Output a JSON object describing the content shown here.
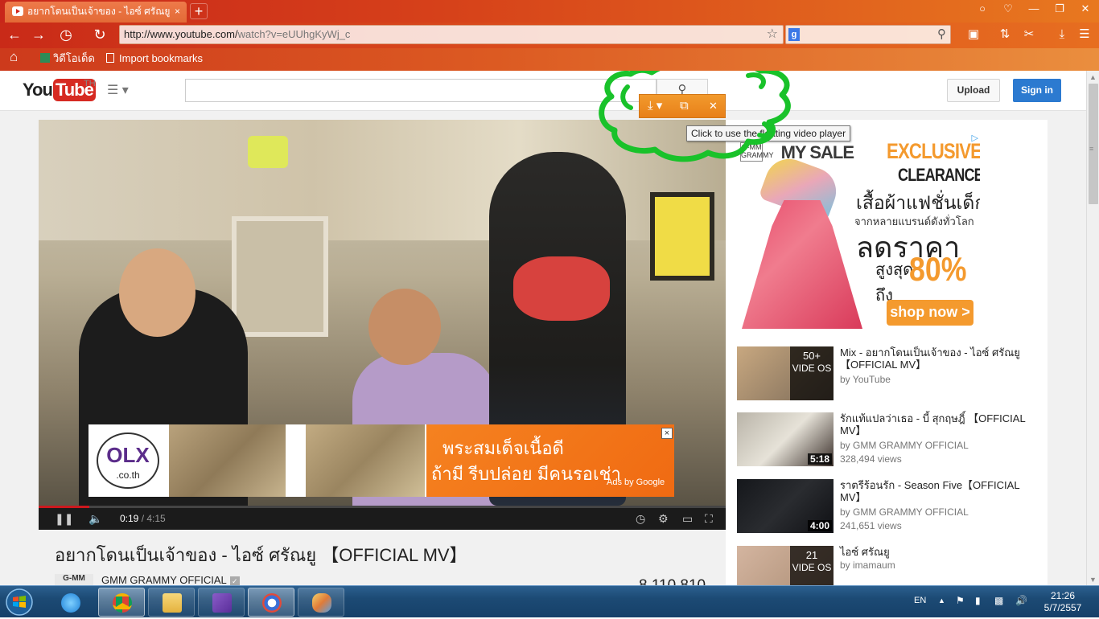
{
  "browser": {
    "tab_title": "อยากโดนเป็นเจ้าของ - ไอซ์ ศรัณยู",
    "tab_close": "×",
    "new_tab": "+",
    "url_base": "http://www.youtube.com/",
    "url_path": "watch?v=eUUhgKyWj_c",
    "search_engine_letter": "g",
    "bookmarks": [
      {
        "label": "วิดีโอเด็ด",
        "icon": "video-icon"
      },
      {
        "label": "Import bookmarks",
        "icon": "document-icon"
      }
    ]
  },
  "youtube": {
    "logo_you": "You",
    "logo_tube": "Tube",
    "region": "TH",
    "search_button_icon": "search-icon",
    "upload_label": "Upload",
    "signin_label": "Sign in"
  },
  "floating_player": {
    "tooltip": "Click to use the floating video player",
    "icons": [
      "download-icon",
      "popout-icon",
      "close-icon"
    ]
  },
  "player": {
    "current_time": "0:19",
    "separator": " / ",
    "duration": "4:15",
    "progress_fraction": 0.074,
    "ad": {
      "brand": "OLX",
      "brand_domain": ".co.th",
      "line1": "พระสมเด็จเนื้อดี",
      "line2": "ถ้ามี รีบปล่อย มีคนรอเช่า",
      "ads_by": "Ads by Google",
      "close": "×"
    }
  },
  "video": {
    "title": "อยากโดนเป็นเจ้าของ - ไอซ์ ศรัณยู 【OFFICIAL MV】",
    "channel": "GMM GRAMMY OFFICIAL",
    "channel_avatar_text": "G-MM",
    "views": "8,110,810"
  },
  "side_ad": {
    "gmm": "G-MM GRAMMY",
    "sale_text": "MY SALE",
    "exclusive": "EXCLUSIVE",
    "clearance": "CLEARANCE",
    "thai_line1": "เสื้อผ้าแฟชั่นเด็ก",
    "thai_line2": "จากหลายแบรนด์ดังทั่วโลก",
    "price_text": "ลดราคา",
    "upto_text": "สูงสุด",
    "upto_text2": "ถึง",
    "percent": "80%",
    "shop_now": "shop now >"
  },
  "related": [
    {
      "title": "Mix - อยากโดนเป็นเจ้าของ - ไอซ์ ศรัณยู 【OFFICIAL MV】",
      "by": "by YouTube",
      "views": "",
      "duration": "",
      "playlist_count": "50+",
      "playlist_label": "VIDE OS"
    },
    {
      "title": "รักแท้แปลว่าเธอ - บี้ สุกฤษฎิ์ 【OFFICIAL MV】",
      "by": "by GMM GRAMMY OFFICIAL",
      "views": "328,494 views",
      "duration": "5:18",
      "playlist_count": "",
      "playlist_label": ""
    },
    {
      "title": "ราตรีร้อนรัก - Season Five【OFFICIAL MV】",
      "by": "by GMM GRAMMY OFFICIAL",
      "views": "241,651 views",
      "duration": "4:00",
      "playlist_count": "",
      "playlist_label": ""
    },
    {
      "title": "ไอซ์ ศรัณยู",
      "by": "by imamaum",
      "views": "",
      "duration": "",
      "playlist_count": "21",
      "playlist_label": "VIDE OS"
    }
  ],
  "taskbar": {
    "lang": "EN",
    "time": "21:26",
    "date": "5/7/2557"
  }
}
